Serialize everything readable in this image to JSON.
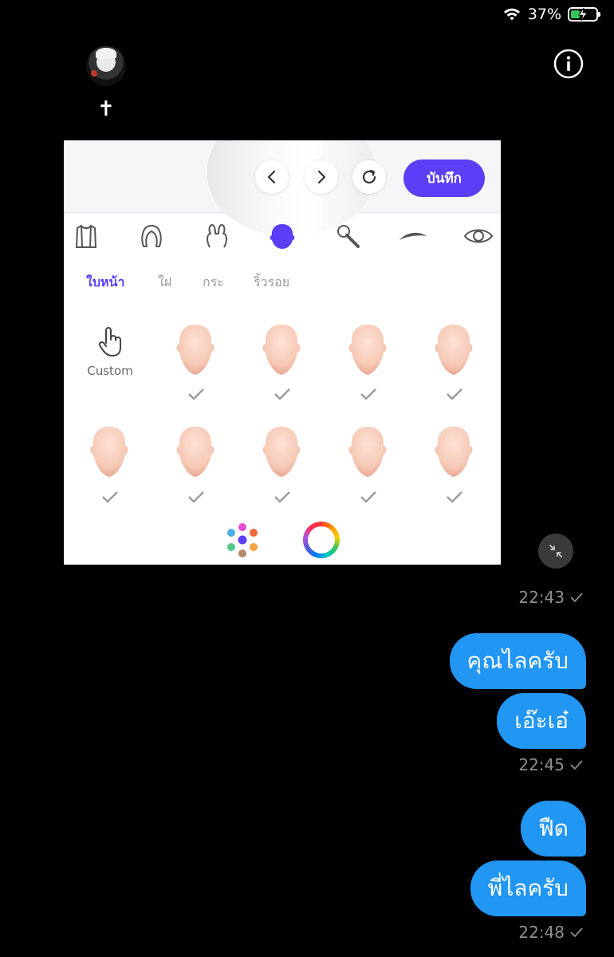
{
  "status_bar": {
    "battery_percent": "37%",
    "battery_level": 0.37
  },
  "chat_header": {
    "contact_name": "✝"
  },
  "shared_image": {
    "save_label": "บันทึก",
    "categories": [
      "clothing",
      "hair",
      "headband",
      "face-shape",
      "microphone",
      "eyebrow",
      "eye"
    ],
    "subtabs": [
      "ใบหน้า",
      "ใฝ",
      "กระ",
      "ริ้วรอย"
    ],
    "active_subtab": "ใบหน้า",
    "custom_label": "Custom",
    "accent_color": "#5b3ef5"
  },
  "messages": [
    {
      "type": "image",
      "time": "22:43"
    },
    {
      "type": "text",
      "text": "คุณไลครับ"
    },
    {
      "type": "text",
      "text": "เอ๊ะเอ๋",
      "time": "22:45"
    },
    {
      "type": "text",
      "text": "ฟืด"
    },
    {
      "type": "text",
      "text": "พี่ไลครับ",
      "time": "22:48"
    }
  ],
  "bubble_color": "#2196f3"
}
